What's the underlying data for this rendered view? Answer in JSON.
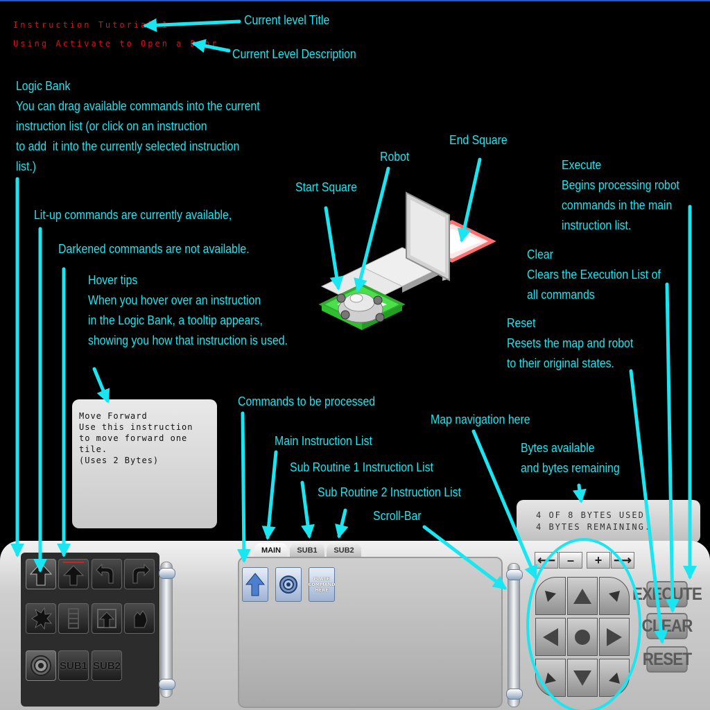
{
  "level": {
    "title": "Instruction Tutorial 1",
    "description": "Using Activate to Open a Door"
  },
  "annotations": {
    "level_title": "Current level Title",
    "level_description": "Current Level Description",
    "logic_bank": "Logic Bank\nYou can drag available commands into the current\ninstruction list (or click on an instruction\nto add  it into the currently selected instruction\nlist.)",
    "lit_up": "Lit-up commands are currently available,",
    "darkened": "Darkened commands are not available.",
    "hover_tips": "Hover tips\nWhen you hover over an instruction\nin the Logic Bank, a tooltip appears,\nshowing you how that instruction is used.",
    "start_square": "Start Square",
    "robot": "Robot",
    "end_square": "End Square",
    "execute": "Execute\nBegins processing robot\ncommands in the main\ninstruction list.",
    "clear": "Clear\nClears the Execution List of\nall commands",
    "reset": "Reset\nResets the map and robot\nto their original states.",
    "commands_to_process": "Commands to be processed",
    "main_list": "Main Instruction List",
    "sub1_list": "Sub Routine 1 Instruction List",
    "sub2_list": "Sub Routine 2 Instruction List",
    "scroll_bar": "Scroll-Bar",
    "map_nav": "Map navigation here",
    "bytes_info": "Bytes available\nand bytes remaining"
  },
  "tooltip": {
    "text": "Move Forward\nUse this instruction\nto move forward one\ntile.\n(Uses 2 Bytes)"
  },
  "bytes": {
    "used": "4 OF 8 BYTES USED",
    "remaining": "4 BYTES REMAINING."
  },
  "logic_bank": {
    "sub1_label": "SUB1",
    "sub2_label": "SUB2"
  },
  "tabs": [
    {
      "label": "MAIN"
    },
    {
      "label": "SUB1"
    },
    {
      "label": "SUB2"
    }
  ],
  "instruction_list": {
    "placeholder": "PLACE COMMAND HERE"
  },
  "map_nav": {
    "left": "⟵",
    "zoom_out": "–",
    "zoom_in": "+",
    "right": "⟶"
  },
  "actions": {
    "execute": "EXECUTE",
    "clear": "CLEAR",
    "reset": "RESET"
  },
  "colors": {
    "annotation": "#19e6f0",
    "level_text": "#e01010",
    "start_square": "#3ddc3d",
    "end_square": "#ff8a8a"
  }
}
